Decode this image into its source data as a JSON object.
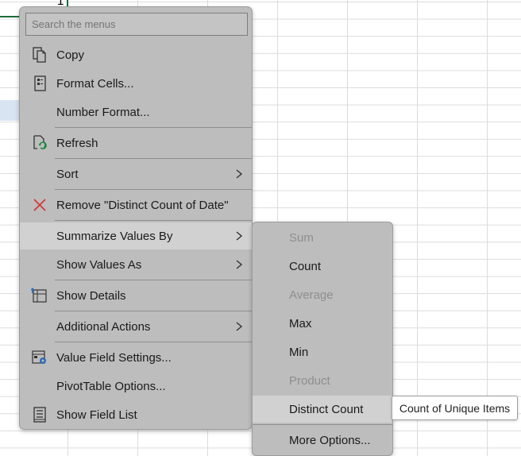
{
  "sheet": {
    "cell_value": "1"
  },
  "context_menu": {
    "search_placeholder": "Search the menus",
    "items": [
      {
        "label": "Copy",
        "icon": "copy-icon"
      },
      {
        "label": "Format Cells...",
        "icon": "format-cells-icon"
      },
      {
        "label": "Number Format...",
        "icon": ""
      },
      {
        "label": "Refresh",
        "icon": "refresh-icon"
      },
      {
        "label": "Sort",
        "icon": "",
        "has_submenu": true
      },
      {
        "label": "Remove \"Distinct Count of Date\"",
        "icon": "remove-icon"
      },
      {
        "label": "Summarize Values By",
        "icon": "",
        "has_submenu": true,
        "highlighted": true
      },
      {
        "label": "Show Values As",
        "icon": "",
        "has_submenu": true
      },
      {
        "label": "Show Details",
        "icon": "show-details-icon"
      },
      {
        "label": "Additional Actions",
        "icon": "",
        "has_submenu": true
      },
      {
        "label": "Value Field Settings...",
        "icon": "value-field-settings-icon"
      },
      {
        "label": "PivotTable Options...",
        "icon": ""
      },
      {
        "label": "Show Field List",
        "icon": "field-list-icon"
      }
    ]
  },
  "submenu": {
    "items": [
      {
        "label": "Sum",
        "disabled": true
      },
      {
        "label": "Count",
        "disabled": false
      },
      {
        "label": "Average",
        "disabled": true
      },
      {
        "label": "Max",
        "disabled": false
      },
      {
        "label": "Min",
        "disabled": false
      },
      {
        "label": "Product",
        "disabled": true
      },
      {
        "label": "Distinct Count",
        "disabled": false,
        "highlighted": true
      },
      {
        "label": "More Options...",
        "disabled": false
      }
    ]
  },
  "tooltip": {
    "text": "Count of Unique Items"
  },
  "colors": {
    "menu_bg": "#bdbdbd",
    "highlight_bg": "#d1d1d1",
    "disabled_text": "#8e8e8e",
    "remove_icon": "#d13438",
    "refresh_icon_green": "#1e8a3c",
    "settings_icon_blue": "#2e6db5"
  }
}
